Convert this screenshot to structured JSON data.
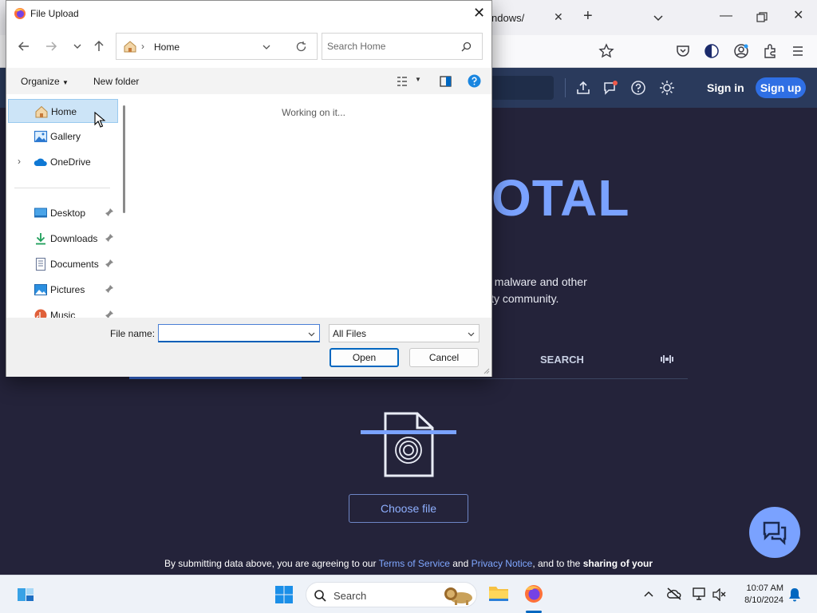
{
  "browser": {
    "tab_title": "ndows/",
    "site": {
      "signin": "Sign in",
      "signup": "Sign up",
      "brand_fragment": "OTAL",
      "tagline_line1": "t malware and other",
      "tagline_line2": "ity community.",
      "search_tab": "SEARCH",
      "choose_file": "Choose file",
      "disclaimer": {
        "pre": "By submitting data above, you are agreeing to our ",
        "tos": "Terms of Service",
        "and": " and ",
        "privacy": "Privacy Notice",
        "post": ", and to the ",
        "bold": "sharing of your"
      }
    }
  },
  "dialog": {
    "title": "File Upload",
    "address": {
      "location": "Home"
    },
    "search": {
      "placeholder": "Search Home"
    },
    "commandbar": {
      "organize": "Organize",
      "new_folder": "New folder"
    },
    "nav": {
      "items": [
        {
          "label": "Home",
          "icon": "home-icon",
          "selected": true
        },
        {
          "label": "Gallery",
          "icon": "gallery-icon"
        },
        {
          "label": "OneDrive",
          "icon": "onedrive-icon"
        },
        {
          "label": "Desktop",
          "icon": "desktop-icon",
          "pinned": true
        },
        {
          "label": "Downloads",
          "icon": "downloads-icon",
          "pinned": true
        },
        {
          "label": "Documents",
          "icon": "documents-icon",
          "pinned": true
        },
        {
          "label": "Pictures",
          "icon": "pictures-icon",
          "pinned": true
        },
        {
          "label": "Music",
          "icon": "music-icon",
          "pinned": true
        }
      ]
    },
    "content": {
      "status": "Working on it..."
    },
    "filename": {
      "label": "File name:",
      "value": ""
    },
    "filetype": {
      "value": "All Files"
    },
    "buttons": {
      "open": "Open",
      "cancel": "Cancel"
    }
  },
  "taskbar": {
    "search_label": "Search",
    "time": "10:07 AM",
    "date": "8/10/2024"
  },
  "colors": {
    "accent": "#0067c0",
    "selection": "#cce4f7",
    "site_header": "#2a3a5c",
    "site_background": "#24233a",
    "brand_blue": "#7aa2ff",
    "signup": "#2f6fe4"
  }
}
